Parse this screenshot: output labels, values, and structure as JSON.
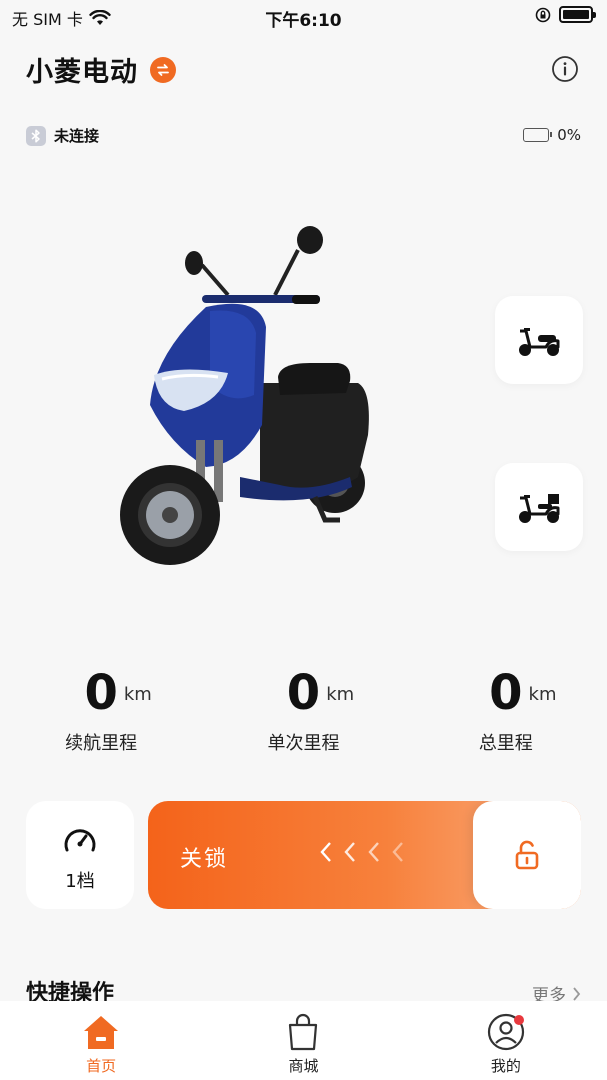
{
  "status_bar": {
    "carrier": "无 SIM 卡",
    "time": "下午6:10"
  },
  "header": {
    "title": "小菱电动"
  },
  "connection": {
    "status": "未连接",
    "battery_percent": "0%"
  },
  "modes": [
    {
      "icon": "scooter-icon"
    },
    {
      "icon": "scooter-cargo-icon"
    }
  ],
  "stats": [
    {
      "value": "0",
      "unit": "km",
      "label": "续航里程"
    },
    {
      "value": "0",
      "unit": "km",
      "label": "单次里程"
    },
    {
      "value": "0",
      "unit": "km",
      "label": "总里程"
    }
  ],
  "gear": {
    "label": "1档"
  },
  "lock": {
    "label": "关锁"
  },
  "quick_actions": {
    "title": "快捷操作",
    "more": "更多"
  },
  "tabs": [
    {
      "label": "首页",
      "icon": "home-icon",
      "active": true
    },
    {
      "label": "商城",
      "icon": "shopping-bag-icon",
      "active": false
    },
    {
      "label": "我的",
      "icon": "profile-icon",
      "active": false
    }
  ],
  "colors": {
    "accent": "#f06a22",
    "background": "#f7f7f7",
    "notification": "#e8383d"
  }
}
